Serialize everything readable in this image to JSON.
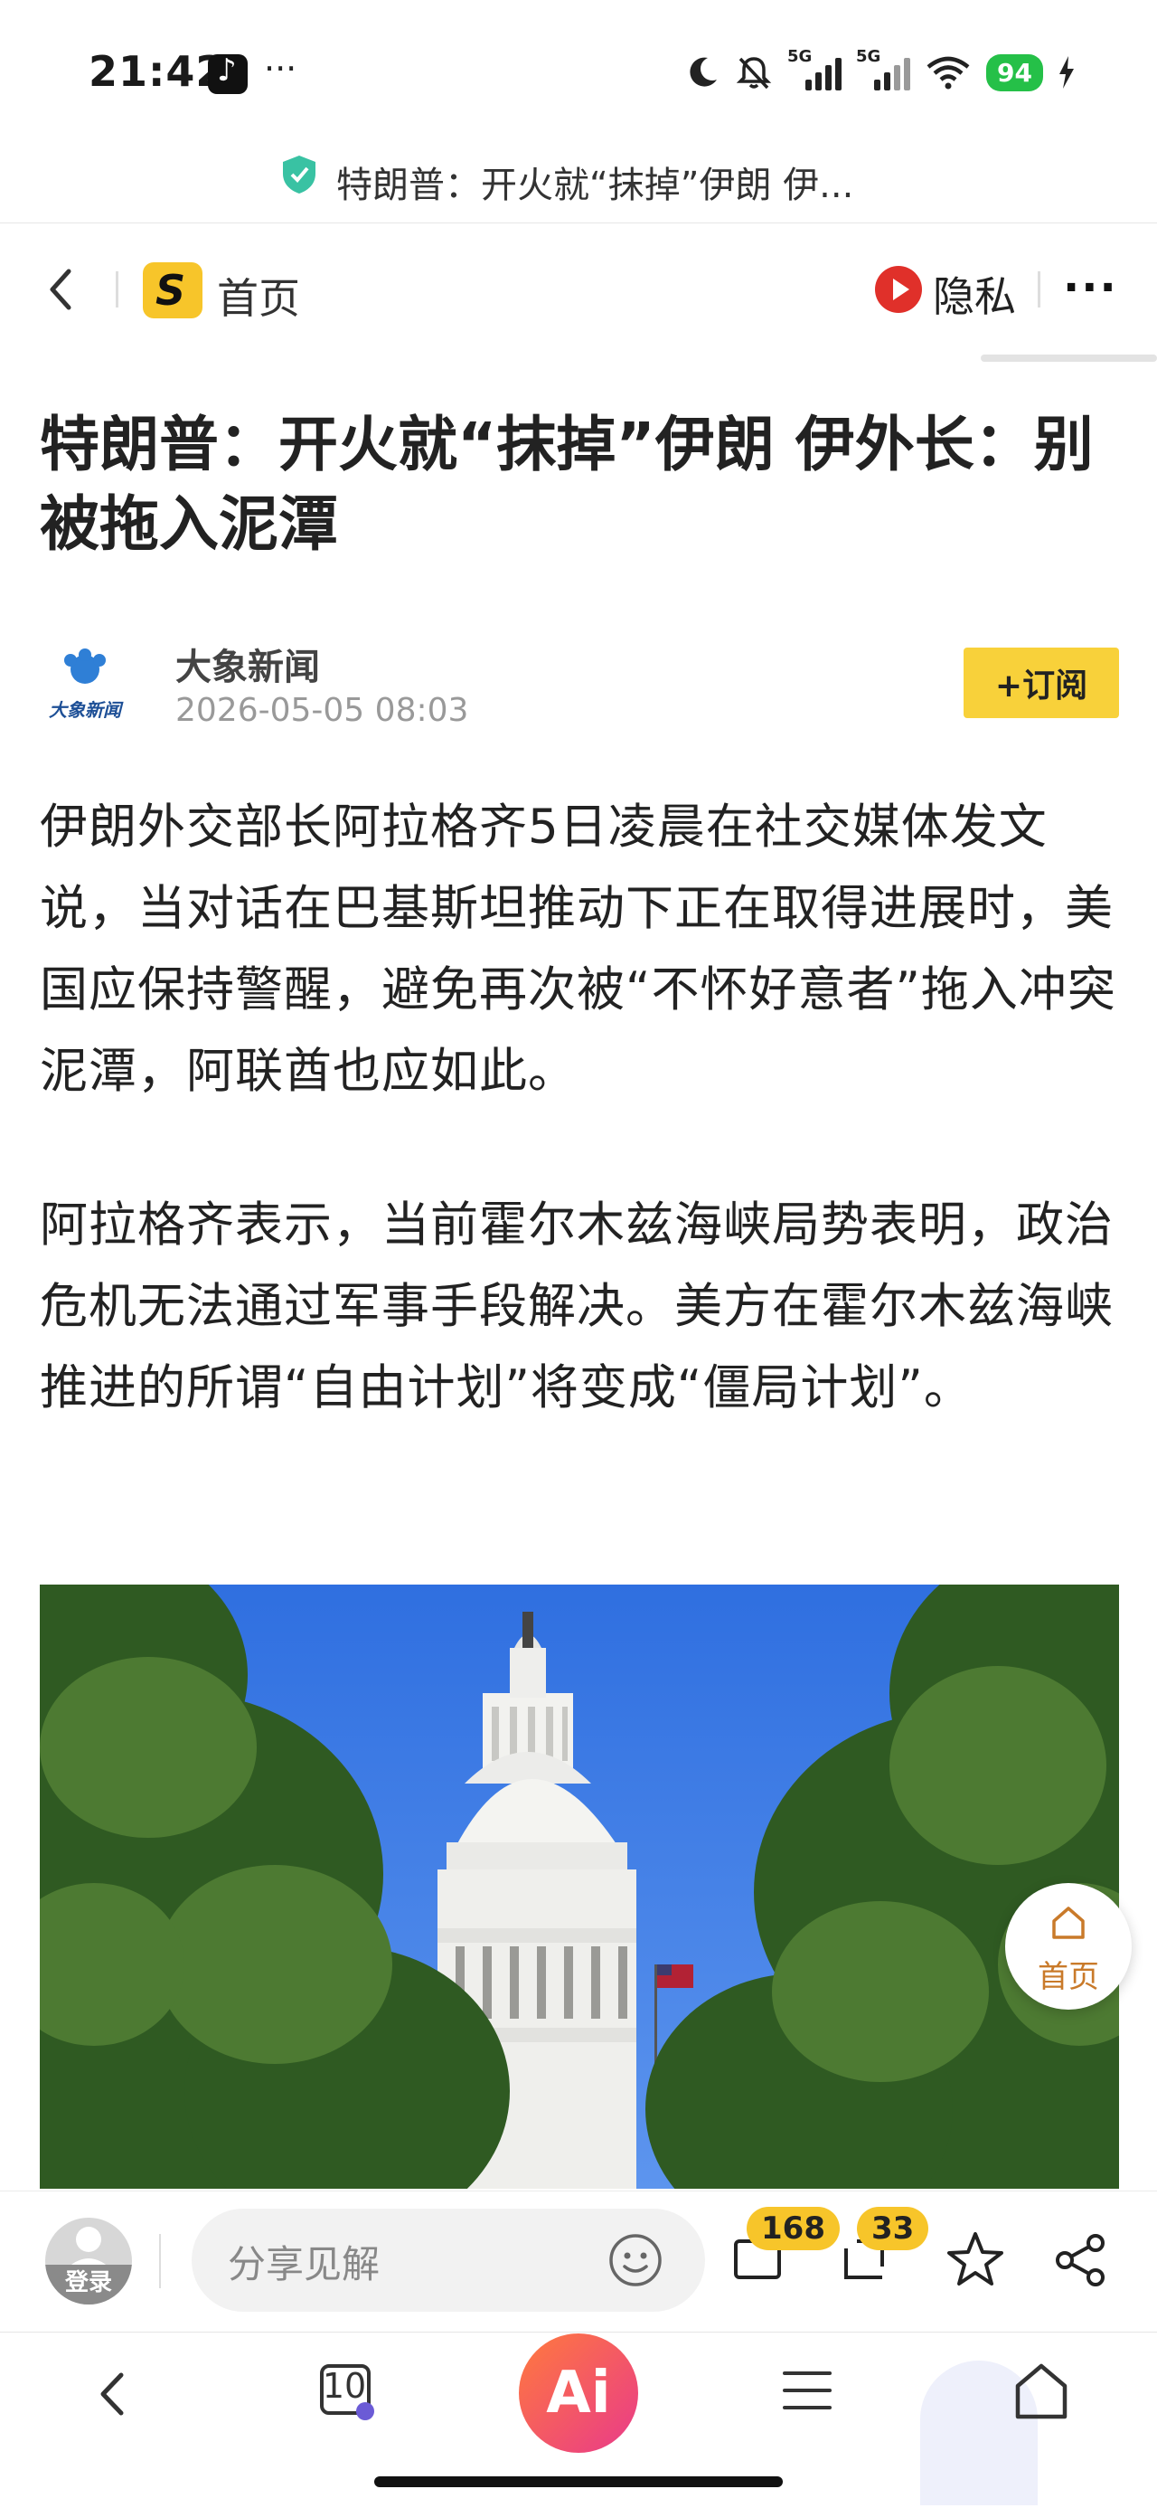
{
  "status_bar": {
    "time": "21:42",
    "more": "···",
    "signal_1": "5G",
    "signal_2": "5G",
    "battery": "94"
  },
  "url_bar": {
    "text": "特朗普：开火就“抹掉”伊朗 伊..."
  },
  "nav": {
    "home_logo": "S",
    "home_label": "首页",
    "privacy_label": "隐私",
    "more": "···"
  },
  "article": {
    "title": "特朗普：开火就“抹掉”伊朗 伊外长：别被拖入泥潭",
    "source_name": "大象新闻",
    "source_logo_text": "大象新闻",
    "published": "2026-05-05 08:03",
    "subscribe_label": "+订阅",
    "paragraphs": [
      "伊朗外交部长阿拉格齐5日凌晨在社交媒体发文说，当对话在巴基斯坦推动下正在取得进展时，美国应保持警醒，避免再次被“不怀好意者”拖入冲突泥潭，阿联酋也应如此。",
      "阿拉格齐表示，当前霍尔木兹海峡局势表明，政治危机无法通过军事手段解决。美方在霍尔木兹海峡推进的所谓“自由计划”将变成“僵局计划”。"
    ]
  },
  "floating_home": {
    "label": "首页"
  },
  "comment_bar": {
    "login_label": "登录",
    "input_placeholder": "分享见解",
    "comment_count": "168",
    "repost_count": "33"
  },
  "browser_nav": {
    "tabs_count": "10",
    "ai_label": "Ai"
  },
  "colors": {
    "accent_yellow": "#f8d13a",
    "battery_green": "#25c048",
    "privacy_red": "#e0302a"
  }
}
